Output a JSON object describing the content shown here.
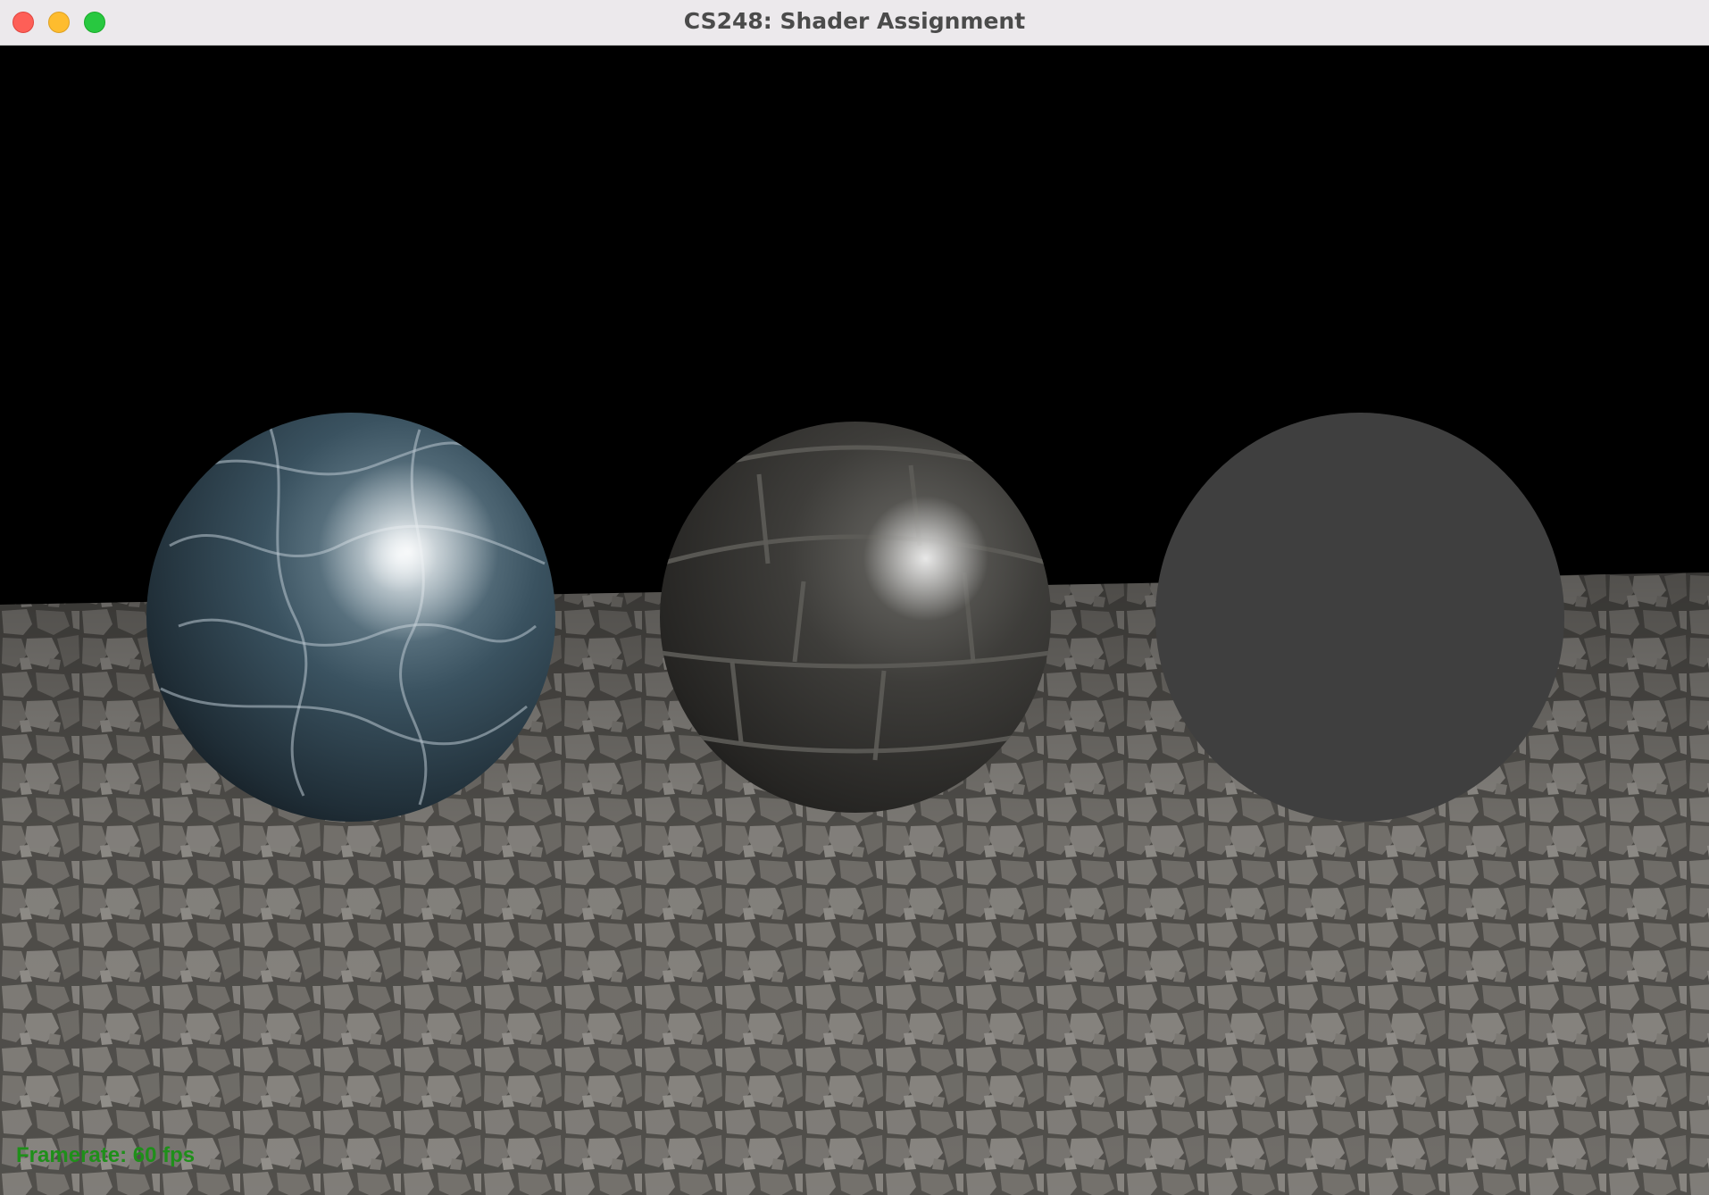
{
  "window": {
    "title": "CS248: Shader Assignment",
    "controls": [
      "close",
      "minimize",
      "zoom"
    ]
  },
  "scene": {
    "background_color": "#000000",
    "floor": {
      "texture": "cobblestone",
      "color": "#6f6d6a"
    },
    "spheres": [
      {
        "material": "marble",
        "base_color": "#2e4350",
        "specular": true
      },
      {
        "material": "brick",
        "base_color": "#3a3936",
        "specular": true
      },
      {
        "material": "flat-gray",
        "base_color": "#3f3f3f",
        "specular": false
      }
    ]
  },
  "status": {
    "framerate_text": "Framerate: 60 fps",
    "color": "#1f8f1a"
  }
}
